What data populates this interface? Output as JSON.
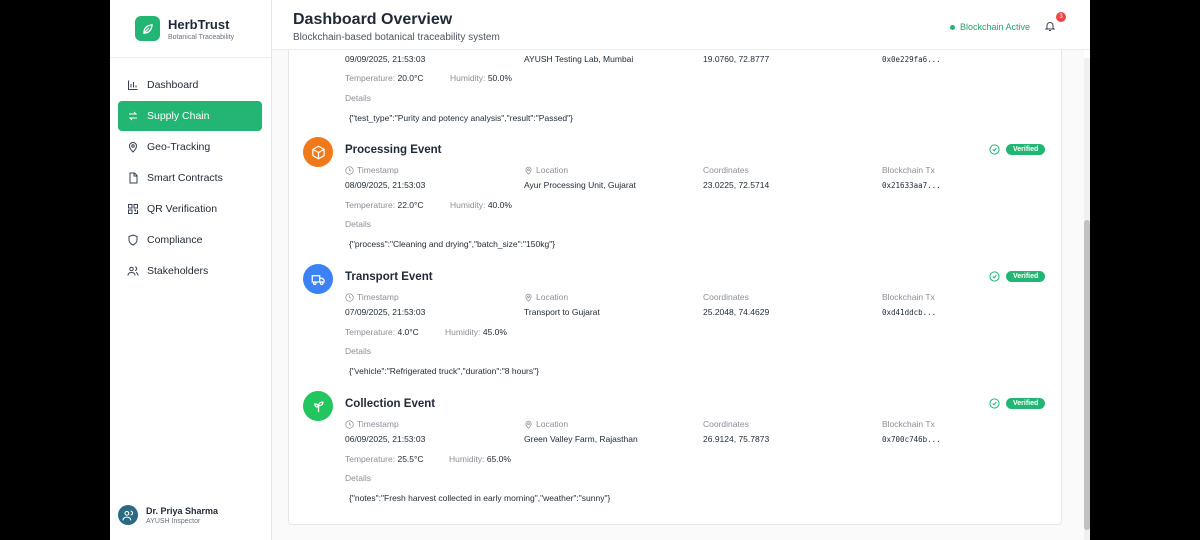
{
  "brand": {
    "name": "HerbTrust",
    "subtitle": "Botanical Traceability"
  },
  "nav": [
    {
      "label": "Dashboard",
      "icon": "bar-chart-icon",
      "active": false
    },
    {
      "label": "Supply Chain",
      "icon": "swap-arrows-icon",
      "active": true
    },
    {
      "label": "Geo-Tracking",
      "icon": "map-pin-icon",
      "active": false
    },
    {
      "label": "Smart Contracts",
      "icon": "document-icon",
      "active": false
    },
    {
      "label": "QR Verification",
      "icon": "qr-code-icon",
      "active": false
    },
    {
      "label": "Compliance",
      "icon": "shield-icon",
      "active": false
    },
    {
      "label": "Stakeholders",
      "icon": "users-icon",
      "active": false
    }
  ],
  "user": {
    "name": "Dr. Priya Sharma",
    "role": "AYUSH Inspector"
  },
  "header": {
    "title": "Dashboard Overview",
    "subtitle": "Blockchain-based botanical traceability system",
    "status": "Blockchain Active",
    "notifications": "3"
  },
  "labels": {
    "timestamp": "Timestamp",
    "location": "Location",
    "coordinates": "Coordinates",
    "blockchain_tx": "Blockchain Tx",
    "temperature": "Temperature:",
    "humidity": "Humidity:",
    "details": "Details",
    "verified": "Verified"
  },
  "partial_event": {
    "timestamp": "09/09/2025, 21:53:03",
    "location": "AYUSH Testing Lab, Mumbai",
    "coordinates": "19.0760, 72.8777",
    "tx": "0x0e229fa6...",
    "temperature": "20.0°C",
    "humidity": "50.0%",
    "details": "{\"test_type\":\"Purity and potency analysis\",\"result\":\"Passed\"}"
  },
  "events": [
    {
      "title": "Processing Event",
      "color": "#f07a1a",
      "icon": "box-icon",
      "timestamp": "08/09/2025, 21:53:03",
      "location": "Ayur Processing Unit, Gujarat",
      "coordinates": "23.0225, 72.5714",
      "tx": "0x21633aa7...",
      "temperature": "22.0°C",
      "humidity": "40.0%",
      "details": "{\"process\":\"Cleaning and drying\",\"batch_size\":\"150kg\"}"
    },
    {
      "title": "Transport Event",
      "color": "#3b82f6",
      "icon": "truck-icon",
      "timestamp": "07/09/2025, 21:53:03",
      "location": "Transport to Gujarat",
      "coordinates": "25.2048, 74.4629",
      "tx": "0xd41ddcb...",
      "temperature": "4.0°C",
      "humidity": "45.0%",
      "details": "{\"vehicle\":\"Refrigerated truck\",\"duration\":\"8 hours\"}"
    },
    {
      "title": "Collection Event",
      "color": "#22c55e",
      "icon": "sprout-icon",
      "timestamp": "06/09/2025, 21:53:03",
      "location": "Green Valley Farm, Rajasthan",
      "coordinates": "26.9124, 75.7873",
      "tx": "0x700c746b...",
      "temperature": "25.5°C",
      "humidity": "65.0%",
      "details": "{\"notes\":\"Fresh harvest collected in early morning\",\"weather\":\"sunny\"}"
    }
  ]
}
